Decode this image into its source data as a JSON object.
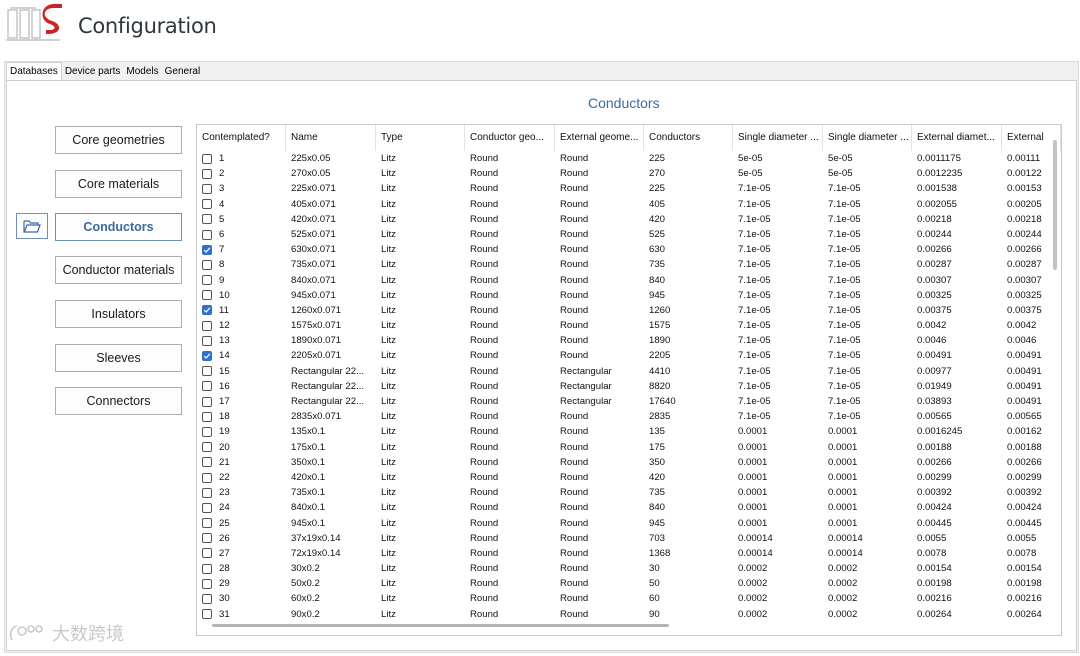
{
  "app": {
    "title": "Configuration"
  },
  "tabs": [
    "Databases",
    "Device parts",
    "Models",
    "General"
  ],
  "section_title": "Conductors",
  "nav": {
    "buttons": [
      "Core geometries",
      "Core materials",
      "Conductors",
      "Conductor materials",
      "Insulators",
      "Sleeves",
      "Connectors"
    ],
    "active": "Conductors"
  },
  "table": {
    "columns": [
      "Contemplated?",
      "Name",
      "Type",
      "Conductor geo...",
      "External geome...",
      "Conductors",
      "Single diameter ...",
      "Single diameter ...",
      "External diamet...",
      "External"
    ],
    "rows": [
      {
        "id": "1",
        "checked": false,
        "cells": [
          "225x0.05",
          "Litz",
          "Round",
          "Round",
          "225",
          "5e-05",
          "5e-05",
          "0.0011175",
          "0.00111"
        ]
      },
      {
        "id": "2",
        "checked": false,
        "cells": [
          "270x0.05",
          "Litz",
          "Round",
          "Round",
          "270",
          "5e-05",
          "5e-05",
          "0.0012235",
          "0.00122"
        ]
      },
      {
        "id": "3",
        "checked": false,
        "cells": [
          "225x0.071",
          "Litz",
          "Round",
          "Round",
          "225",
          "7.1e-05",
          "7.1e-05",
          "0.001538",
          "0.00153"
        ]
      },
      {
        "id": "4",
        "checked": false,
        "cells": [
          "405x0.071",
          "Litz",
          "Round",
          "Round",
          "405",
          "7.1e-05",
          "7.1e-05",
          "0.002055",
          "0.00205"
        ]
      },
      {
        "id": "5",
        "checked": false,
        "cells": [
          "420x0.071",
          "Litz",
          "Round",
          "Round",
          "420",
          "7.1e-05",
          "7.1e-05",
          "0.00218",
          "0.00218"
        ]
      },
      {
        "id": "6",
        "checked": false,
        "cells": [
          "525x0.071",
          "Litz",
          "Round",
          "Round",
          "525",
          "7.1e-05",
          "7.1e-05",
          "0.00244",
          "0.00244"
        ]
      },
      {
        "id": "7",
        "checked": true,
        "cells": [
          "630x0.071",
          "Litz",
          "Round",
          "Round",
          "630",
          "7.1e-05",
          "7.1e-05",
          "0.00266",
          "0.00266"
        ]
      },
      {
        "id": "8",
        "checked": false,
        "cells": [
          "735x0.071",
          "Litz",
          "Round",
          "Round",
          "735",
          "7.1e-05",
          "7.1e-05",
          "0.00287",
          "0.00287"
        ]
      },
      {
        "id": "9",
        "checked": false,
        "cells": [
          "840x0.071",
          "Litz",
          "Round",
          "Round",
          "840",
          "7.1e-05",
          "7.1e-05",
          "0.00307",
          "0.00307"
        ]
      },
      {
        "id": "10",
        "checked": false,
        "cells": [
          "945x0.071",
          "Litz",
          "Round",
          "Round",
          "945",
          "7.1e-05",
          "7.1e-05",
          "0.00325",
          "0.00325"
        ]
      },
      {
        "id": "11",
        "checked": true,
        "cells": [
          "1260x0.071",
          "Litz",
          "Round",
          "Round",
          "1260",
          "7.1e-05",
          "7.1e-05",
          "0.00375",
          "0.00375"
        ]
      },
      {
        "id": "12",
        "checked": false,
        "cells": [
          "1575x0.071",
          "Litz",
          "Round",
          "Round",
          "1575",
          "7.1e-05",
          "7.1e-05",
          "0.0042",
          "0.0042"
        ]
      },
      {
        "id": "13",
        "checked": false,
        "cells": [
          "1890x0.071",
          "Litz",
          "Round",
          "Round",
          "1890",
          "7.1e-05",
          "7.1e-05",
          "0.0046",
          "0.0046"
        ]
      },
      {
        "id": "14",
        "checked": true,
        "cells": [
          "2205x0.071",
          "Litz",
          "Round",
          "Round",
          "2205",
          "7.1e-05",
          "7.1e-05",
          "0.00491",
          "0.00491"
        ]
      },
      {
        "id": "15",
        "checked": false,
        "cells": [
          "Rectangular 22...",
          "Litz",
          "Round",
          "Rectangular",
          "4410",
          "7.1e-05",
          "7.1e-05",
          "0.00977",
          "0.00491"
        ]
      },
      {
        "id": "16",
        "checked": false,
        "cells": [
          "Rectangular 22...",
          "Litz",
          "Round",
          "Rectangular",
          "8820",
          "7.1e-05",
          "7.1e-05",
          "0.01949",
          "0.00491"
        ]
      },
      {
        "id": "17",
        "checked": false,
        "cells": [
          "Rectangular 22...",
          "Litz",
          "Round",
          "Rectangular",
          "17640",
          "7.1e-05",
          "7.1e-05",
          "0.03893",
          "0.00491"
        ]
      },
      {
        "id": "18",
        "checked": false,
        "cells": [
          "2835x0.071",
          "Litz",
          "Round",
          "Round",
          "2835",
          "7.1e-05",
          "7.1e-05",
          "0.00565",
          "0.00565"
        ]
      },
      {
        "id": "19",
        "checked": false,
        "cells": [
          "135x0.1",
          "Litz",
          "Round",
          "Round",
          "135",
          "0.0001",
          "0.0001",
          "0.0016245",
          "0.00162"
        ]
      },
      {
        "id": "20",
        "checked": false,
        "cells": [
          "175x0.1",
          "Litz",
          "Round",
          "Round",
          "175",
          "0.0001",
          "0.0001",
          "0.00188",
          "0.00188"
        ]
      },
      {
        "id": "21",
        "checked": false,
        "cells": [
          "350x0.1",
          "Litz",
          "Round",
          "Round",
          "350",
          "0.0001",
          "0.0001",
          "0.00266",
          "0.00266"
        ]
      },
      {
        "id": "22",
        "checked": false,
        "cells": [
          "420x0.1",
          "Litz",
          "Round",
          "Round",
          "420",
          "0.0001",
          "0.0001",
          "0.00299",
          "0.00299"
        ]
      },
      {
        "id": "23",
        "checked": false,
        "cells": [
          "735x0.1",
          "Litz",
          "Round",
          "Round",
          "735",
          "0.0001",
          "0.0001",
          "0.00392",
          "0.00392"
        ]
      },
      {
        "id": "24",
        "checked": false,
        "cells": [
          "840x0.1",
          "Litz",
          "Round",
          "Round",
          "840",
          "0.0001",
          "0.0001",
          "0.00424",
          "0.00424"
        ]
      },
      {
        "id": "25",
        "checked": false,
        "cells": [
          "945x0.1",
          "Litz",
          "Round",
          "Round",
          "945",
          "0.0001",
          "0.0001",
          "0.00445",
          "0.00445"
        ]
      },
      {
        "id": "26",
        "checked": false,
        "cells": [
          "37x19x0.14",
          "Litz",
          "Round",
          "Round",
          "703",
          "0.00014",
          "0.00014",
          "0.0055",
          "0.0055"
        ]
      },
      {
        "id": "27",
        "checked": false,
        "cells": [
          "72x19x0.14",
          "Litz",
          "Round",
          "Round",
          "1368",
          "0.00014",
          "0.00014",
          "0.0078",
          "0.0078"
        ]
      },
      {
        "id": "28",
        "checked": false,
        "cells": [
          "30x0.2",
          "Litz",
          "Round",
          "Round",
          "30",
          "0.0002",
          "0.0002",
          "0.00154",
          "0.00154"
        ]
      },
      {
        "id": "29",
        "checked": false,
        "cells": [
          "50x0.2",
          "Litz",
          "Round",
          "Round",
          "50",
          "0.0002",
          "0.0002",
          "0.00198",
          "0.00198"
        ]
      },
      {
        "id": "30",
        "checked": false,
        "cells": [
          "60x0.2",
          "Litz",
          "Round",
          "Round",
          "60",
          "0.0002",
          "0.0002",
          "0.00216",
          "0.00216"
        ]
      },
      {
        "id": "31",
        "checked": false,
        "cells": [
          "90x0.2",
          "Litz",
          "Round",
          "Round",
          "90",
          "0.0002",
          "0.0002",
          "0.00264",
          "0.00264"
        ]
      }
    ]
  },
  "watermark": {
    "text": "大数跨境",
    "icon": "brand-logo-icon"
  },
  "colors": {
    "accent": "#3b6aa0",
    "checkbox": "#2f6fcf",
    "logo_red": "#cc2222"
  }
}
